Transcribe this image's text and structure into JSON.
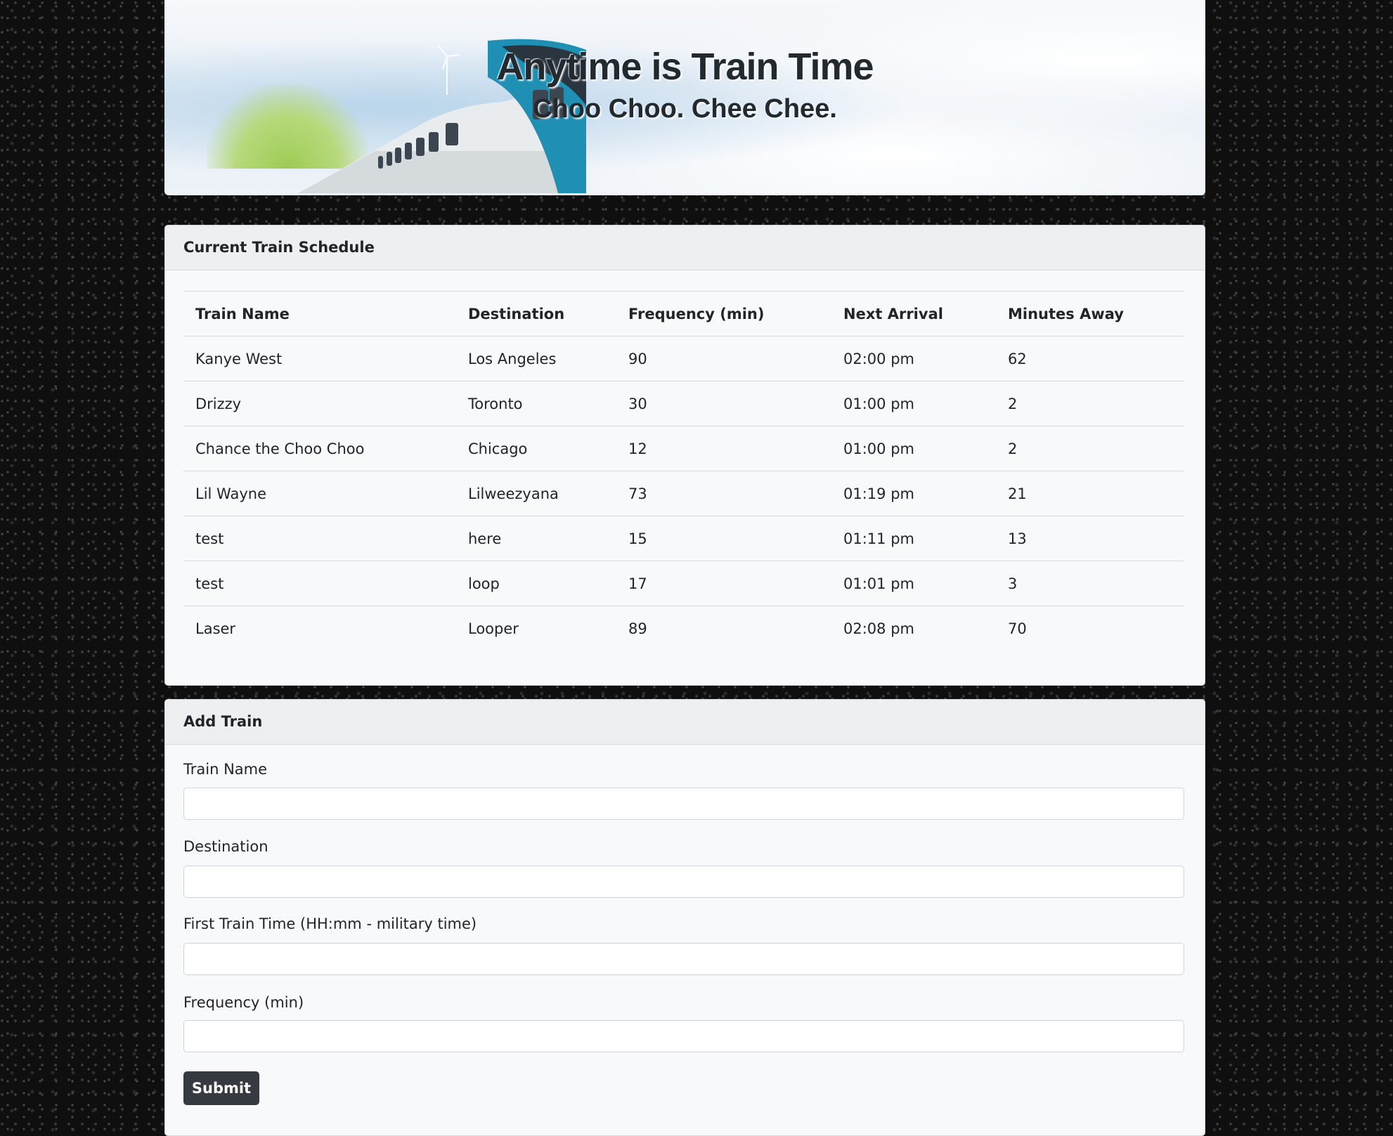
{
  "header": {
    "title": "Anytime is Train Time",
    "subtitle": "Choo Choo. Chee Chee."
  },
  "schedule": {
    "heading": "Current Train Schedule",
    "columns": [
      "Train Name",
      "Destination",
      "Frequency (min)",
      "Next Arrival",
      "Minutes Away"
    ],
    "rows": [
      [
        "Kanye West",
        "Los Angeles",
        "90",
        "02:00 pm",
        "62"
      ],
      [
        "Drizzy",
        "Toronto",
        "30",
        "01:00 pm",
        "2"
      ],
      [
        "Chance the Choo Choo",
        "Chicago",
        "12",
        "01:00 pm",
        "2"
      ],
      [
        "Lil Wayne",
        "Lilweezyana",
        "73",
        "01:19 pm",
        "21"
      ],
      [
        "test",
        "here",
        "15",
        "01:11 pm",
        "13"
      ],
      [
        "test",
        "loop",
        "17",
        "01:01 pm",
        "3"
      ],
      [
        "Laser",
        "Looper",
        "89",
        "02:08 pm",
        "70"
      ]
    ]
  },
  "add_train": {
    "heading": "Add Train",
    "fields": {
      "train_name": {
        "label": "Train Name",
        "value": ""
      },
      "destination": {
        "label": "Destination",
        "value": ""
      },
      "first_time": {
        "label": "First Train Time (HH:mm - military time)",
        "value": ""
      },
      "frequency": {
        "label": "Frequency (min)",
        "value": ""
      }
    },
    "submit_label": "Submit"
  },
  "colors": {
    "page_background": "#0f0f0f",
    "card_background": "#f8f9fa",
    "card_header": "#eeeff1",
    "button": "#343a40",
    "train_accent": "#1f8fb4"
  }
}
